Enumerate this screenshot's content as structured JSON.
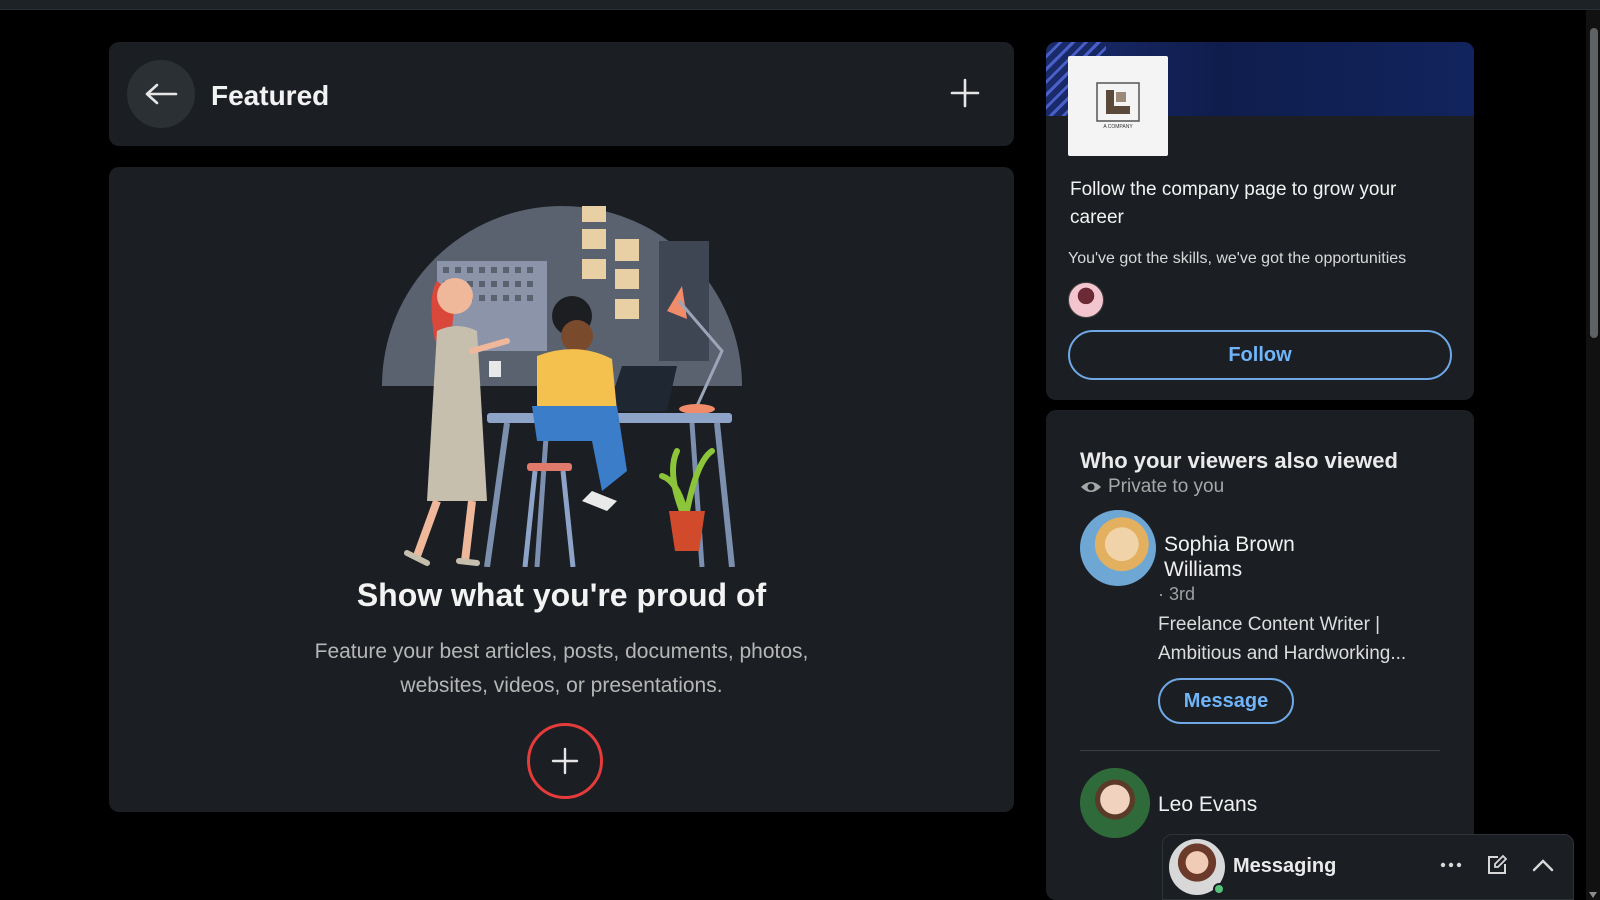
{
  "featured": {
    "title": "Featured",
    "empty_title": "Show what you're proud of",
    "empty_description": "Feature your best articles, posts, documents, photos, websites, videos, or presentations."
  },
  "ad": {
    "headline": "Follow  the company page to grow your career",
    "subtext": "You've got the skills, we've got the opportunities",
    "follow_label": "Follow"
  },
  "viewers": {
    "title": "Who your viewers also viewed",
    "privacy_label": "Private to you",
    "people": [
      {
        "name": "Sophia Brown Williams",
        "degree": "· 3rd",
        "headline": "Freelance Content Writer | Ambitious and Hardworking...",
        "action_label": "Message"
      },
      {
        "name": "Leo Evans"
      }
    ]
  },
  "messaging": {
    "label": "Messaging"
  },
  "colors": {
    "accent_blue": "#70b5f9",
    "highlight_red": "#e53b3b",
    "card_bg": "#1b1f23"
  },
  "icons": [
    "back-arrow-icon",
    "plus-icon",
    "eye-icon",
    "more-icon",
    "compose-icon",
    "chevron-up-icon"
  ]
}
